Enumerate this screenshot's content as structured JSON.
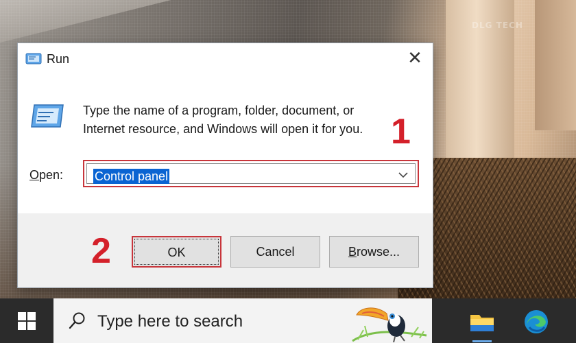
{
  "dialog": {
    "title": "Run",
    "close_glyph": "✕",
    "prompt_line1": "Type the name of a program, folder, document, or",
    "prompt_line2": "Internet resource, and Windows will open it for you.",
    "open_label_underlined": "O",
    "open_label_rest": "pen:",
    "open_value": "Control panel",
    "ok_label": "OK",
    "cancel_label": "Cancel",
    "browse_label_underlined": "B",
    "browse_label_rest": "rowse..."
  },
  "annotations": {
    "step1": "1",
    "step2": "2",
    "highlight_color": "#c8353b"
  },
  "watermark": "DLG TECH",
  "taskbar": {
    "search_placeholder": "Type here to search",
    "pinned": [
      "file-explorer-icon",
      "edge-icon"
    ]
  },
  "icons": {
    "run_icon": "run-app-icon",
    "dropdown": "chevron-down-icon",
    "start": "windows-start-icon",
    "search": "search-icon"
  },
  "colors": {
    "selection": "#0a64d2",
    "taskbar": "#2b2b2b",
    "dialog_bg": "#f0f0f0"
  }
}
